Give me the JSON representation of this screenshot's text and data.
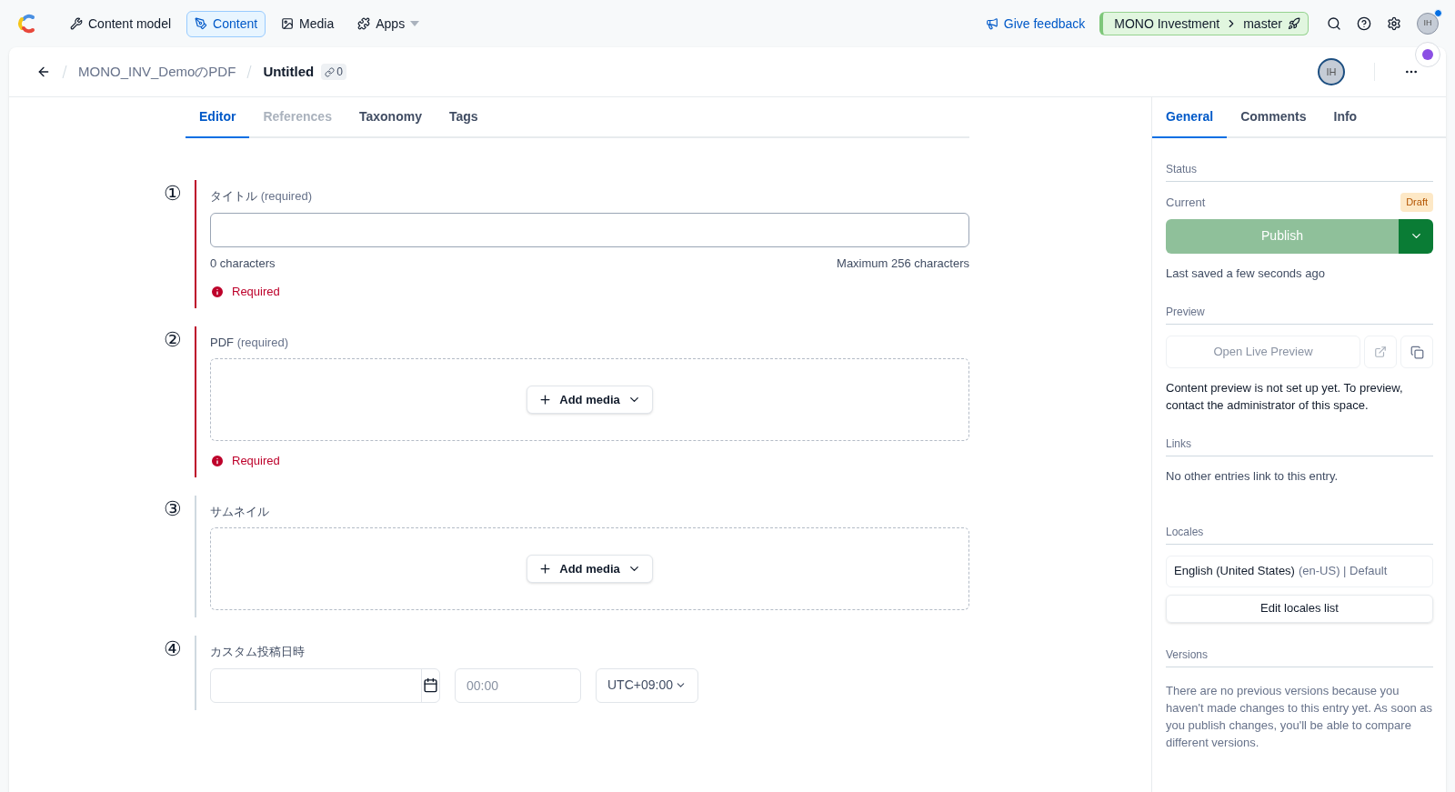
{
  "nav": {
    "items": [
      {
        "kind": "wrench",
        "label": "Content model",
        "selected": false
      },
      {
        "kind": "pen",
        "label": "Content",
        "selected": true
      },
      {
        "kind": "image",
        "label": "Media",
        "selected": false
      },
      {
        "kind": "puzzle",
        "label": "Apps",
        "selected": false,
        "dropdown": true
      }
    ],
    "feedback": "Give feedback",
    "space": "MONO Investment",
    "environment": "master",
    "avatar": "IH",
    "notification": true
  },
  "entry": {
    "breadcrumb": "MONO_INV_DemoのPDF",
    "title": "Untitled",
    "links_count": "0",
    "avatar": "IH"
  },
  "tabs": [
    {
      "label": "Editor",
      "selected": true,
      "disabled": false
    },
    {
      "label": "References",
      "selected": false,
      "disabled": true
    },
    {
      "label": "Taxonomy",
      "selected": false,
      "disabled": false
    },
    {
      "label": "Tags",
      "selected": false,
      "disabled": false
    }
  ],
  "fields": [
    {
      "number": "①",
      "kind": "text",
      "label": "タイトル",
      "hint": "(required)",
      "invalid": true,
      "count": "0 characters",
      "max": "Maximum 256 characters",
      "error": "Required"
    },
    {
      "number": "②",
      "kind": "media",
      "label": "PDF",
      "hint": "(required)",
      "invalid": true,
      "button": "Add media",
      "error": "Required"
    },
    {
      "number": "③",
      "kind": "media",
      "label": "サムネイル",
      "invalid": false,
      "button": "Add media"
    },
    {
      "number": "④",
      "kind": "datetime",
      "label": "カスタム投稿日時",
      "invalid": false,
      "time_placeholder": "00:00",
      "timezone": "UTC+09:00"
    }
  ],
  "sidebar": {
    "tabs": [
      {
        "label": "General",
        "selected": true
      },
      {
        "label": "Comments",
        "selected": false
      },
      {
        "label": "Info",
        "selected": false
      }
    ],
    "status": {
      "heading": "Status",
      "current": "Current",
      "badge": "Draft",
      "publish": "Publish",
      "publish_disabled": true,
      "saved": "Last saved a few seconds ago"
    },
    "preview": {
      "heading": "Preview",
      "button": "Open Live Preview",
      "note": "Content preview is not set up yet. To preview, contact the administrator of this space."
    },
    "links": {
      "heading": "Links",
      "note": "No other entries link to this entry."
    },
    "locales": {
      "heading": "Locales",
      "locale": "English (United States)",
      "code": "(en-US) | Default",
      "button": "Edit locales list"
    },
    "versions": {
      "heading": "Versions",
      "note": "There are no previous versions because you haven't made changes to this entry yet. As soon as you publish changes, you'll be able to compare different versions."
    }
  }
}
